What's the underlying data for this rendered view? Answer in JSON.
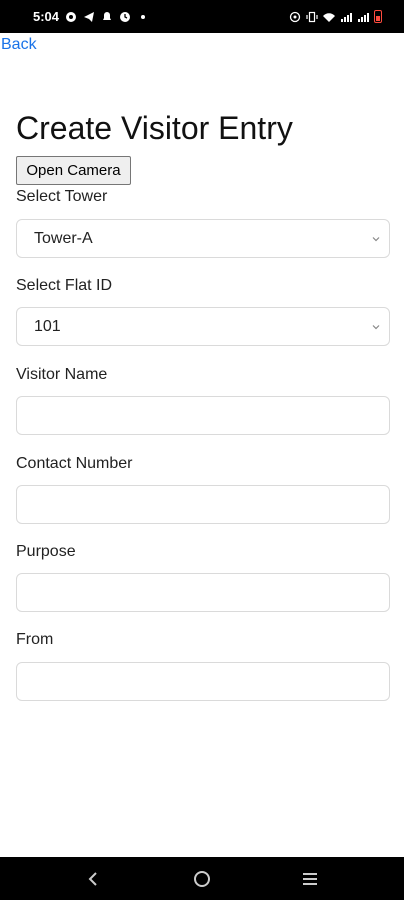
{
  "status_bar": {
    "time": "5:04"
  },
  "nav": {
    "back_label": "Back"
  },
  "page": {
    "title": "Create Visitor Entry",
    "camera_button_label": "Open Camera"
  },
  "form": {
    "tower": {
      "label": "Select Tower",
      "selected": "Tower-A"
    },
    "flat": {
      "label": "Select Flat ID",
      "selected": "101"
    },
    "visitor_name": {
      "label": "Visitor Name",
      "value": ""
    },
    "contact_number": {
      "label": "Contact Number",
      "value": ""
    },
    "purpose": {
      "label": "Purpose",
      "value": ""
    },
    "from": {
      "label": "From",
      "value": ""
    }
  },
  "colors": {
    "link": "#1a73e8",
    "battery": "#ff4b3e"
  }
}
